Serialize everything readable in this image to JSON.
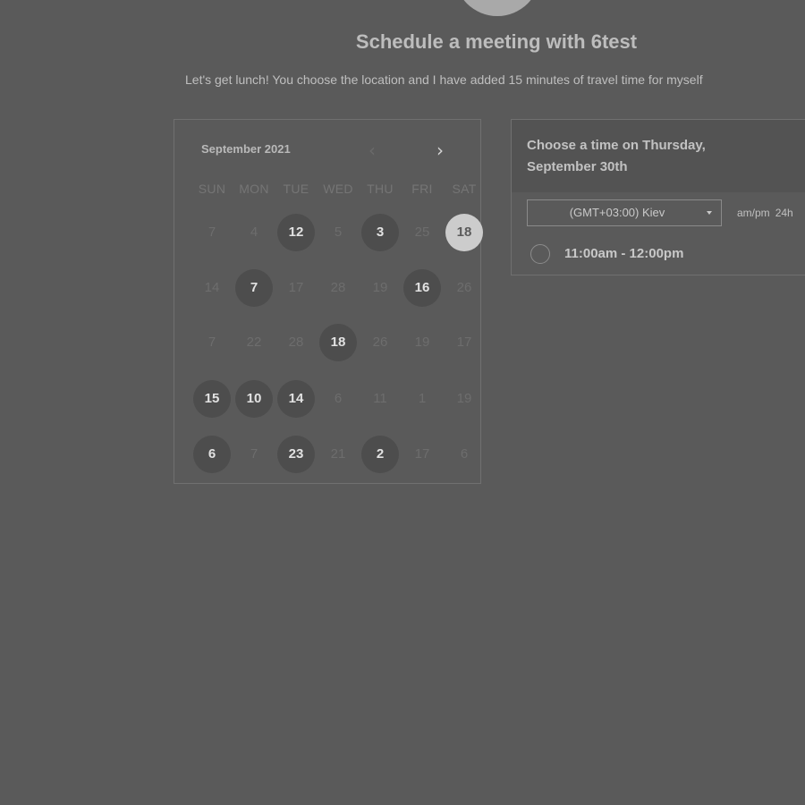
{
  "header": {
    "title": "Schedule a meeting with 6test",
    "subtitle": "Let's get lunch! You choose the location and I have added 15 minutes of travel time for myself"
  },
  "calendar": {
    "month_label": "September 2021",
    "prev_icon": "chevron-left-icon",
    "next_icon": "chevron-right-icon",
    "weekdays": [
      "SUN",
      "MON",
      "TUE",
      "WED",
      "THU",
      "FRI",
      "SAT"
    ],
    "weeks": [
      [
        {
          "label": "7",
          "state": "unavailable"
        },
        {
          "label": "4",
          "state": "unavailable"
        },
        {
          "label": "12",
          "state": "available"
        },
        {
          "label": "5",
          "state": "unavailable"
        },
        {
          "label": "3",
          "state": "available"
        },
        {
          "label": "25",
          "state": "unavailable"
        },
        {
          "label": "18",
          "state": "selected"
        }
      ],
      [
        {
          "label": "14",
          "state": "unavailable"
        },
        {
          "label": "7",
          "state": "available"
        },
        {
          "label": "17",
          "state": "unavailable"
        },
        {
          "label": "28",
          "state": "unavailable"
        },
        {
          "label": "19",
          "state": "unavailable"
        },
        {
          "label": "16",
          "state": "available"
        },
        {
          "label": "26",
          "state": "unavailable"
        }
      ],
      [
        {
          "label": "7",
          "state": "unavailable"
        },
        {
          "label": "22",
          "state": "unavailable"
        },
        {
          "label": "28",
          "state": "unavailable"
        },
        {
          "label": "18",
          "state": "available"
        },
        {
          "label": "26",
          "state": "unavailable"
        },
        {
          "label": "19",
          "state": "unavailable"
        },
        {
          "label": "17",
          "state": "unavailable"
        }
      ],
      [
        {
          "label": "15",
          "state": "available"
        },
        {
          "label": "10",
          "state": "available"
        },
        {
          "label": "14",
          "state": "available"
        },
        {
          "label": "6",
          "state": "unavailable"
        },
        {
          "label": "11",
          "state": "unavailable"
        },
        {
          "label": "1",
          "state": "unavailable"
        },
        {
          "label": "19",
          "state": "unavailable"
        }
      ],
      [
        {
          "label": "6",
          "state": "available"
        },
        {
          "label": "7",
          "state": "unavailable"
        },
        {
          "label": "23",
          "state": "available"
        },
        {
          "label": "21",
          "state": "unavailable"
        },
        {
          "label": "2",
          "state": "available"
        },
        {
          "label": "17",
          "state": "unavailable"
        },
        {
          "label": "6",
          "state": "unavailable"
        }
      ]
    ]
  },
  "times": {
    "heading": "Choose a time on Thursday, September 30th",
    "timezone": "(GMT+03:00) Kiev",
    "format_ampm": "am/pm",
    "format_24h": "24h",
    "slots": [
      {
        "label": "11:00am - 12:00pm"
      }
    ]
  },
  "colors": {
    "background": "#5a5a5a",
    "available_day": "#4d4d4d",
    "selected_day": "#cccccc"
  }
}
